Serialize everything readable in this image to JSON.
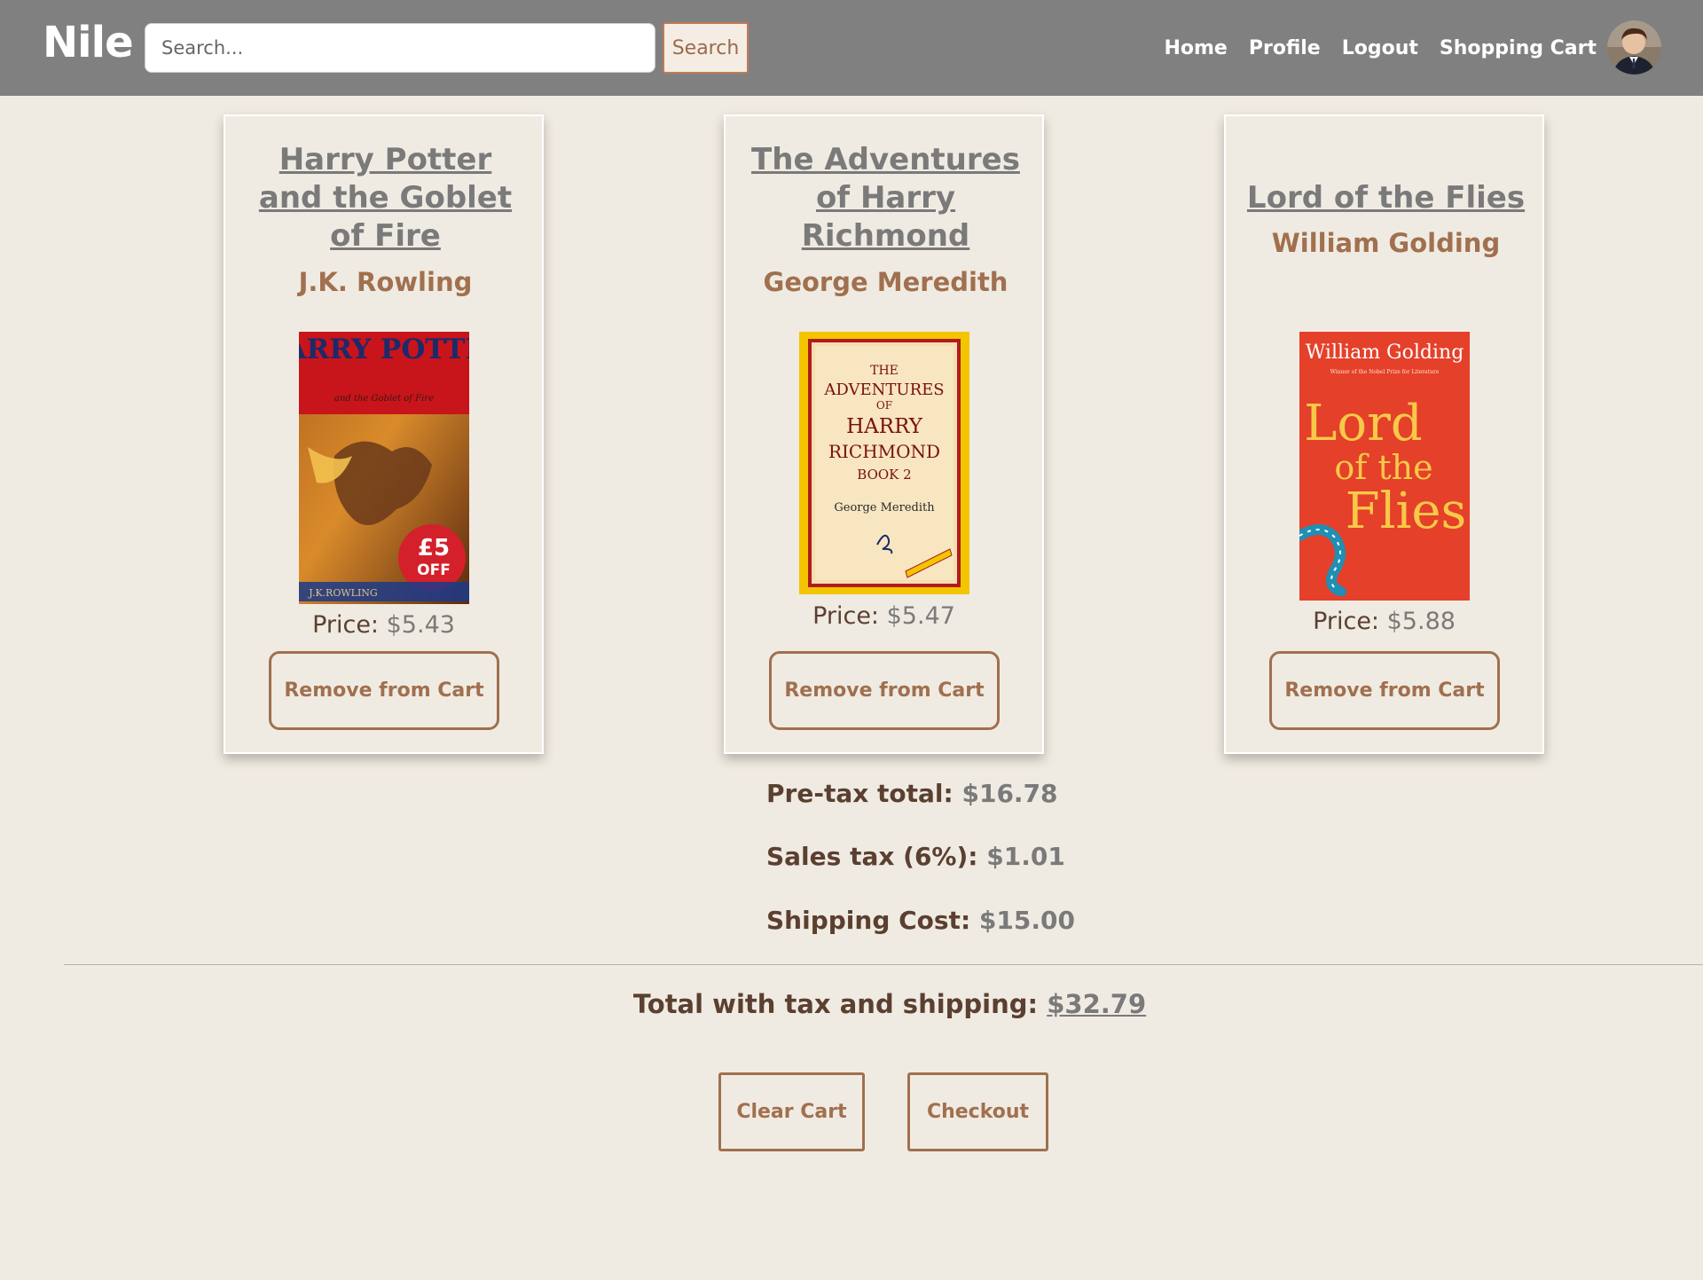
{
  "navbar": {
    "brand": "Nile",
    "search_placeholder": "Search...",
    "search_button_label": "Search",
    "links": [
      "Home",
      "Profile",
      "Logout",
      "Shopping Cart"
    ],
    "avatar_icon": "user-avatar-photo"
  },
  "cart_items": [
    {
      "title": "Harry Potter and the Goblet of Fire",
      "author": "J.K. Rowling",
      "cover_text": {
        "top": "HARRY POTTER",
        "sub": "and the Goblet of Fire",
        "badge_big": "£5",
        "badge_small": "OFF",
        "bottom": "J.K.ROWLING"
      },
      "price_label": "Price:",
      "price": "$5.43",
      "remove_label": "Remove from Cart"
    },
    {
      "title": "The Adventures of Harry Richmond",
      "author": "George Meredith",
      "cover_text": {
        "line1": "THE",
        "line2": "ADVENTURES",
        "line3": "OF",
        "line4": "HARRY",
        "line5": "RICHMOND",
        "line6": "BOOK 2",
        "author": "George Meredith"
      },
      "price_label": "Price:",
      "price": "$5.47",
      "remove_label": "Remove from Cart"
    },
    {
      "title": "Lord of the Flies",
      "author": "William Golding",
      "cover_text": {
        "author": "William Golding",
        "tagline": "Winner of the Nobel Prize for Literature",
        "line1": "Lord",
        "line2": "of the",
        "line3": "Flies"
      },
      "price_label": "Price:",
      "price": "$5.88",
      "remove_label": "Remove from Cart"
    }
  ],
  "totals": {
    "pretax_label": "Pre-tax total:",
    "pretax_value": "$16.78",
    "tax_label": "Sales tax (6%):",
    "tax_value": "$1.01",
    "shipping_label": "Shipping Cost:",
    "shipping_value": "$15.00",
    "grand_label": "Total with tax and shipping:",
    "grand_value": "$32.79"
  },
  "actions": {
    "clear_label": "Clear Cart",
    "checkout_label": "Checkout"
  },
  "colors": {
    "navbar": "#808080",
    "page_background": "#f0ebe2",
    "accent_brown": "#a0704f",
    "text_dark": "#5b3f30",
    "link_gray": "#7a7a7a"
  }
}
